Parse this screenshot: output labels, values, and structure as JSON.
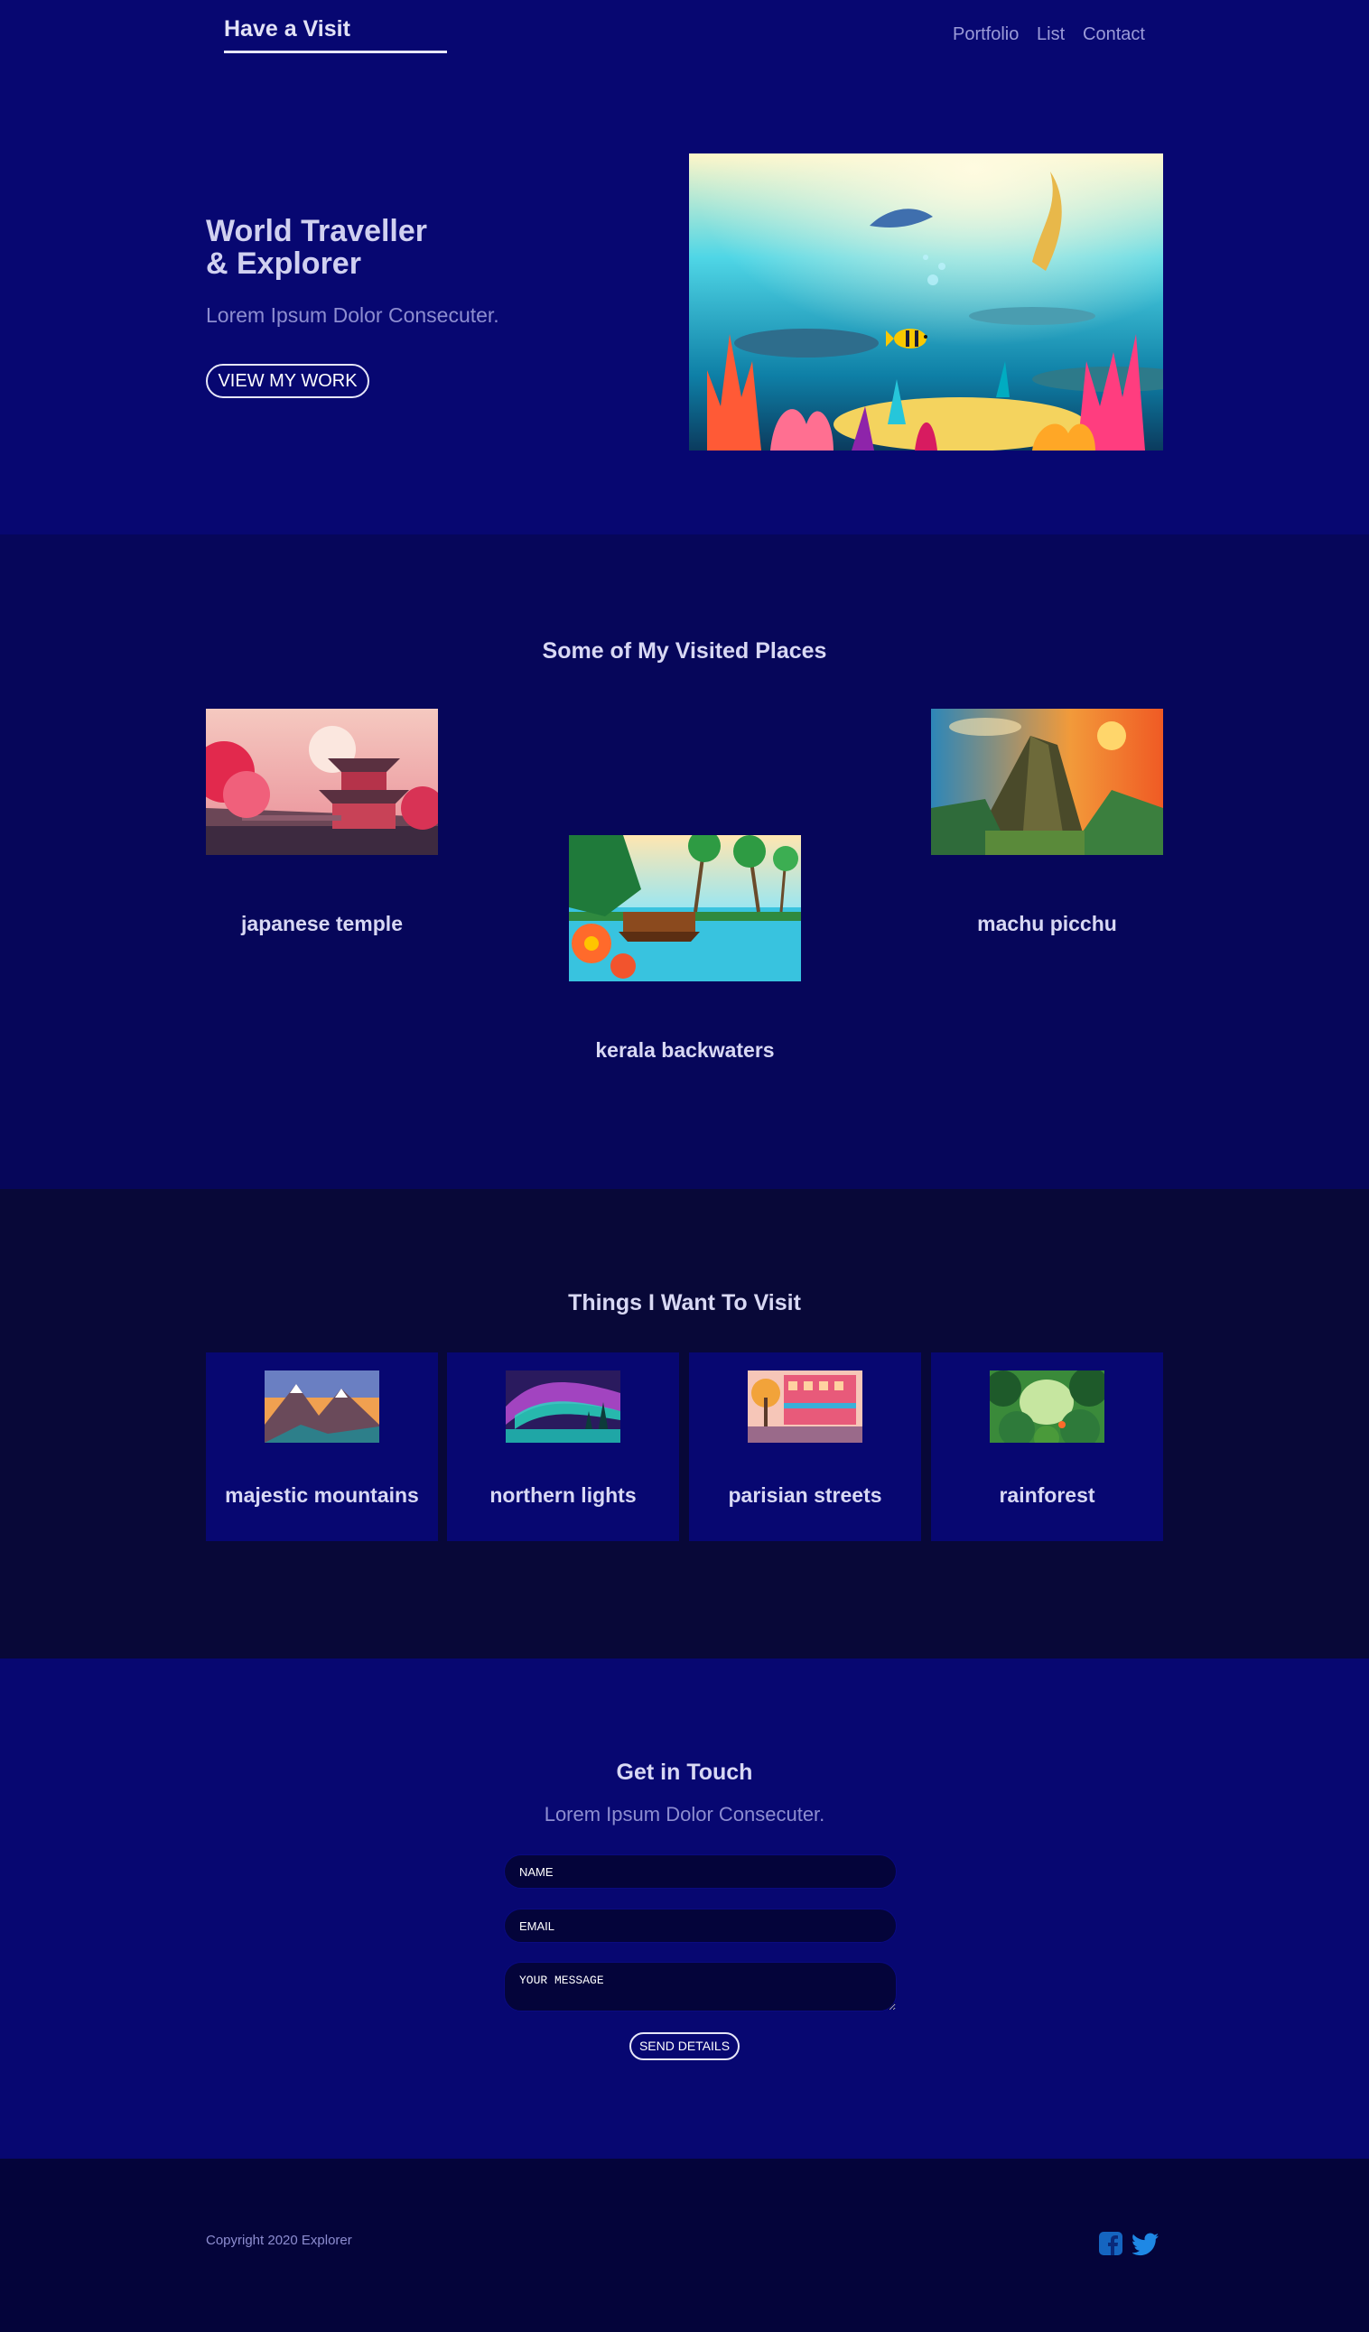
{
  "header": {
    "logo": "Have a Visit",
    "nav": [
      "Portfolio",
      "List",
      "Contact"
    ]
  },
  "hero": {
    "title_line1": "World Traveller",
    "title_line2": "& Explorer",
    "subtitle": "Lorem Ipsum Dolor Consecuter.",
    "button": "VIEW MY WORK"
  },
  "visited": {
    "title": "Some of My Visited Places",
    "places": [
      "japanese temple",
      "kerala backwaters",
      "machu picchu"
    ]
  },
  "wishlist": {
    "title": "Things I Want To Visit",
    "items": [
      "majestic mountains",
      "northern lights",
      "parisian streets",
      "rainforest"
    ]
  },
  "contact": {
    "title": "Get in Touch",
    "subtitle": "Lorem Ipsum Dolor Consecuter.",
    "name_placeholder": "NAME",
    "email_placeholder": "EMAIL",
    "message_placeholder": "YOUR MESSAGE",
    "button": "SEND DETAILS"
  },
  "footer": {
    "copyright": "Copyright 2020 Explorer",
    "social_icons": [
      "facebook-icon",
      "twitter-icon"
    ]
  },
  "colors": {
    "primary_bg": "#070771",
    "visited_bg": "#06065a",
    "wishlist_bg": "#080838",
    "footer_bg": "#04043a",
    "text": "#d8d8f4",
    "muted_text": "#8d8dd0",
    "facebook": "#1565c0",
    "twitter": "#1e88e5"
  }
}
